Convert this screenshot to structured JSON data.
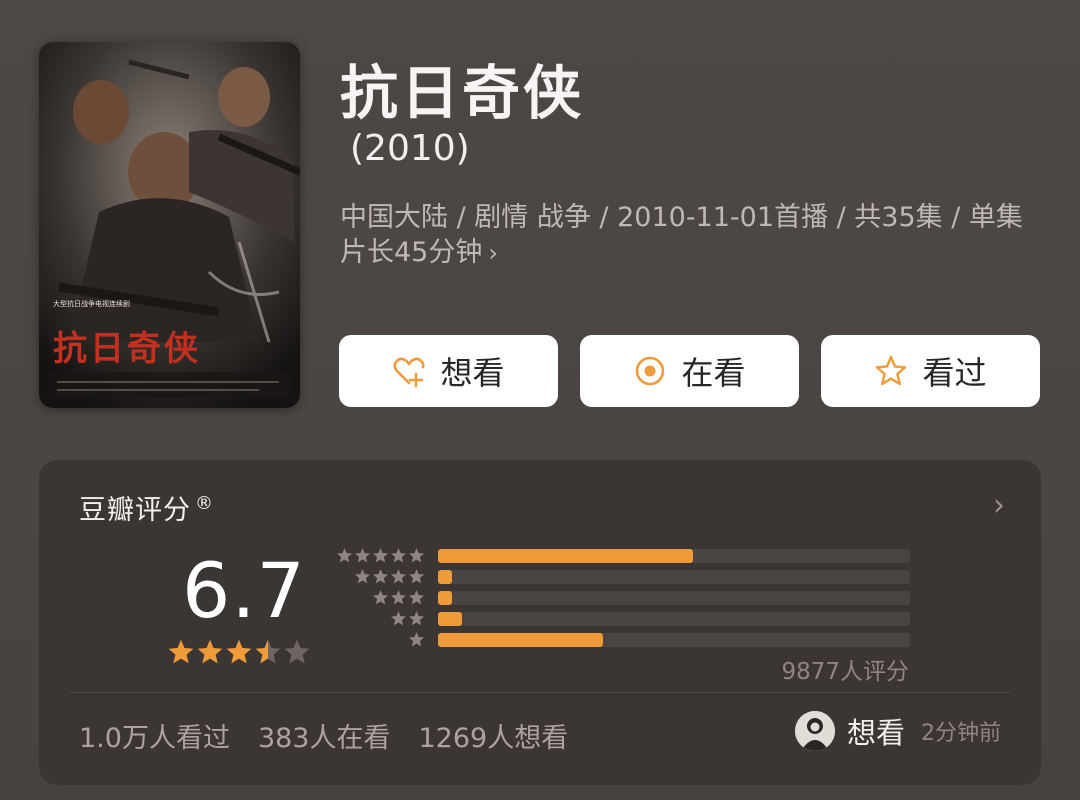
{
  "show": {
    "title": "抗日奇侠",
    "year": "(2010)",
    "meta": "中国大陆 / 剧情 战争 / 2010-11-01首播 / 共35集 / 单集片长45分钟",
    "meta_chevron": "›"
  },
  "poster": {
    "caption_top": "大型抗日战争电视连续剧",
    "caption_title": "抗日奇侠"
  },
  "actions": {
    "want": {
      "label": "想看",
      "icon": "heart-plus-icon"
    },
    "watching": {
      "label": "在看",
      "icon": "target-circle-icon"
    },
    "watched": {
      "label": "看过",
      "icon": "star-outline-icon"
    }
  },
  "rating": {
    "label": "豆瓣评分",
    "trademark": "®",
    "arrow": "›",
    "score": "6.7",
    "stars": 3.5,
    "count_text": "9877人评分",
    "distribution": [
      {
        "stars": 5,
        "fraction": 0.54
      },
      {
        "stars": 4,
        "fraction": 0.03
      },
      {
        "stars": 3,
        "fraction": 0.03
      },
      {
        "stars": 2,
        "fraction": 0.05
      },
      {
        "stars": 1,
        "fraction": 0.35
      }
    ]
  },
  "stats": {
    "watched": "1.0万人看过",
    "watching": "383人在看",
    "want": "1269人想看"
  },
  "activity": {
    "action": "想看",
    "time": "2分钟前"
  },
  "colors": {
    "accent": "#ef9b3a",
    "background": "#4b4543",
    "card": "#3b3634",
    "star_empty": "#6c6563"
  }
}
